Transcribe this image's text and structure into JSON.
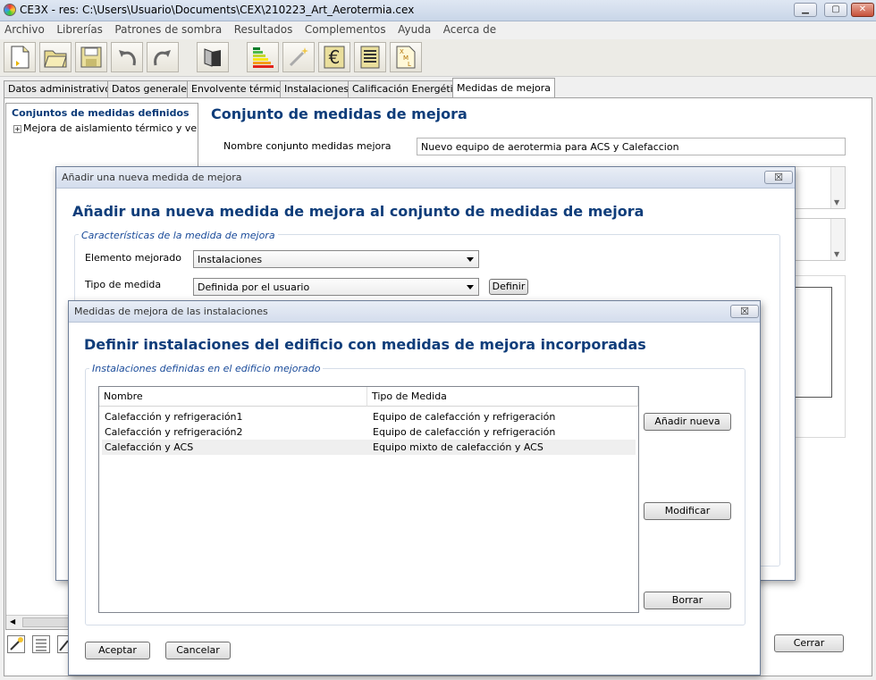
{
  "window": {
    "title": "CE3X - res: C:\\Users\\Usuario\\Documents\\CEX\\210223_Art_Aerotermia.cex"
  },
  "menu": [
    "Archivo",
    "Librerías",
    "Patrones de sombra",
    "Resultados",
    "Complementos",
    "Ayuda",
    "Acerca de"
  ],
  "toolbar": [
    "new-file-icon",
    "open-folder-icon",
    "save-icon",
    "undo-icon",
    "redo-icon",
    "building-icon",
    "energy-rating-icon",
    "wand-icon",
    "euro-icon",
    "report-icon",
    "xml-icon"
  ],
  "tabs": [
    "Datos administrativos",
    "Datos generales",
    "Envolvente térmica",
    "Instalaciones",
    "Calificación Energética",
    "Medidas de mejora"
  ],
  "tree": {
    "root": "Conjuntos de medidas definidos",
    "child": "Mejora de aislamiento térmico y ventan"
  },
  "main": {
    "heading": "Conjunto de medidas de mejora",
    "name_label": "Nombre conjunto medidas mejora",
    "name_value": "Nuevo equipo de aerotermia para ACS y Calefaccion",
    "close_label": "Cerrar"
  },
  "dialog1": {
    "title": "Añadir una nueva medida de mejora",
    "close": "☒",
    "heading": "Añadir una nueva medida de mejora al conjunto de medidas de mejora",
    "group": "Características de la medida de mejora",
    "elemento_label": "Elemento mejorado",
    "elemento_value": "Instalaciones",
    "tipo_label": "Tipo de medida",
    "tipo_value": "Definida por el usuario",
    "definir_label": "Definir"
  },
  "dialog2": {
    "title": "Medidas de mejora de las instalaciones",
    "close": "☒",
    "heading": "Definir instalaciones del edificio con medidas de mejora incorporadas",
    "group": "Instalaciones definidas en el edificio mejorado",
    "columns": [
      "Nombre",
      "Tipo de Medida"
    ],
    "rows": [
      {
        "name": "Calefacción y refrigeración1",
        "type": "Equipo de calefacción y refrigeración"
      },
      {
        "name": "Calefacción y refrigeración2",
        "type": "Equipo de calefacción y refrigeración"
      },
      {
        "name": "Calefacción y ACS",
        "type": "Equipo mixto de calefacción y ACS"
      }
    ],
    "add_label": "Añadir nueva",
    "modify_label": "Modificar",
    "delete_label": "Borrar",
    "accept_label": "Aceptar",
    "cancel_label": "Cancelar"
  }
}
